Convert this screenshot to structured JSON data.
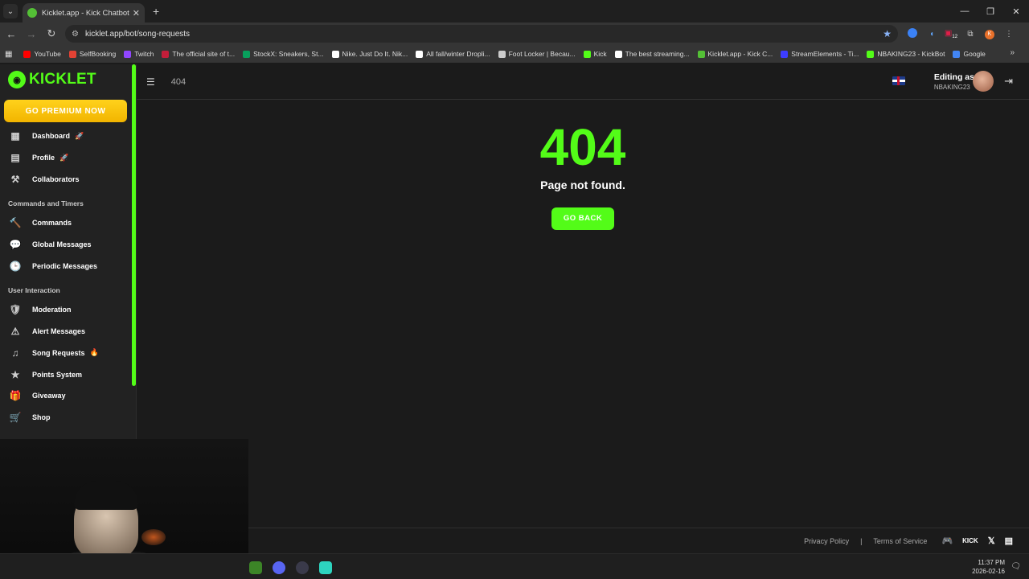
{
  "browser": {
    "tab_title": "Kicklet.app - Kick Chatbot and (",
    "url": "kicklet.app/bot/song-requests",
    "extension_badge": "12",
    "profile_initial": "K",
    "bookmarks": [
      {
        "label": "YouTube",
        "color": "#ff0000"
      },
      {
        "label": "SelfBooking",
        "color": "#e34234"
      },
      {
        "label": "Twitch",
        "color": "#9146ff"
      },
      {
        "label": "The official site of t...",
        "color": "#c41e3a"
      },
      {
        "label": "StockX: Sneakers, St...",
        "color": "#08a05c"
      },
      {
        "label": "Nike. Just Do It. Nik...",
        "color": "#ffffff"
      },
      {
        "label": "All fall/winter Dropli...",
        "color": "#ffffff"
      },
      {
        "label": "Foot Locker | Becau...",
        "color": "#cccccc"
      },
      {
        "label": "Kick",
        "color": "#53fc18"
      },
      {
        "label": "The best streaming...",
        "color": "#ffffff"
      },
      {
        "label": "Kicklet.app - Kick C...",
        "color": "#54c036"
      },
      {
        "label": "StreamElements - Ti...",
        "color": "#3d3dff"
      },
      {
        "label": "NBAKING23 - KickBot",
        "color": "#53fc18"
      },
      {
        "label": "Google",
        "color": "#4285f4"
      }
    ]
  },
  "sidebar": {
    "brand": "KICKLET",
    "premium_label": "GO PREMIUM NOW",
    "items_top": [
      {
        "label": "Dashboard",
        "badge": "🚀",
        "icon": "▦"
      },
      {
        "label": "Profile",
        "badge": "🚀",
        "icon": "▤"
      },
      {
        "label": "Collaborators",
        "icon": "⚒"
      }
    ],
    "section_commands": "Commands and Timers",
    "items_commands": [
      {
        "label": "Commands",
        "icon": "🔨"
      },
      {
        "label": "Global Messages",
        "icon": "💬"
      },
      {
        "label": "Periodic Messages",
        "icon": "🕒"
      }
    ],
    "section_user": "User Interaction",
    "items_user": [
      {
        "label": "Moderation",
        "icon": "🛡"
      },
      {
        "label": "Alert Messages",
        "icon": "⚠"
      },
      {
        "label": "Song Requests",
        "badge": "🔥",
        "icon": "♫"
      },
      {
        "label": "Points System",
        "icon": "★"
      },
      {
        "label": "Giveaway",
        "icon": "🎁"
      },
      {
        "label": "Shop",
        "icon": "🛒"
      }
    ]
  },
  "header": {
    "breadcrumb": "404",
    "editing_as": "Editing as",
    "username": "NBAKING23"
  },
  "main": {
    "code": "404",
    "message": "Page not found.",
    "button": "GO BACK"
  },
  "footer": {
    "privacy": "Privacy Policy",
    "separator": "|",
    "terms": "Terms of Service",
    "kick": "KICK",
    "x": "𝕏"
  },
  "taskbar": {
    "time": "11:37 PM",
    "date": "2026-02-16"
  }
}
